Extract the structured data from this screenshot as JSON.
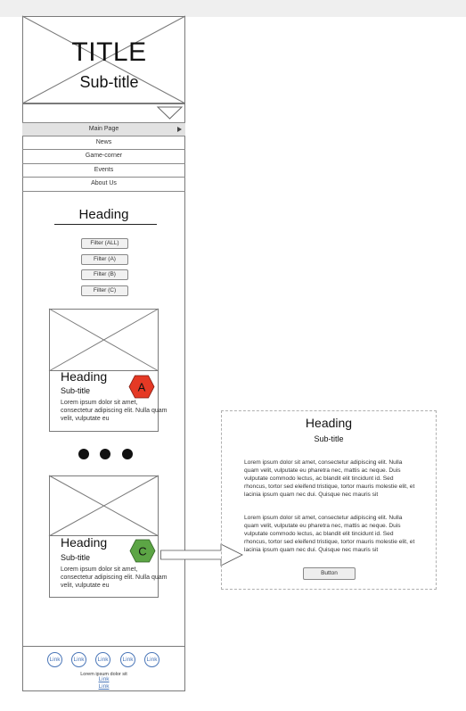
{
  "header": {
    "title": "TITLE",
    "subtitle": "Sub-title"
  },
  "nav": {
    "items": [
      "Main Page",
      "News",
      "Game-corner",
      "Events",
      "About Us"
    ],
    "active_index": 0
  },
  "section": {
    "heading": "Heading"
  },
  "filters": [
    "Filter (ALL)",
    "Filter (A)",
    "Filter (B)",
    "Filter (C)"
  ],
  "cards": [
    {
      "heading": "Heading",
      "subtitle": "Sub-title",
      "badge": "A",
      "badge_color": "#e53925",
      "text": "Lorem ipsum dolor sit amet, consectetur adipiscing elit. Nulla quam velit, vulputate eu"
    },
    {
      "heading": "Heading",
      "subtitle": "Sub-title",
      "badge": "C",
      "badge_color": "#5ca545",
      "text": "Lorem ipsum dolor sit amet, consectetur adipiscing elit. Nulla quam velit, vulputate eu"
    }
  ],
  "detail": {
    "heading": "Heading",
    "subtitle": "Sub-title",
    "paragraphs": [
      "Lorem ipsum dolor sit amet, consectetur adipiscing elit. Nulla quam velit, vulputate eu pharetra nec, mattis ac neque. Duis vulputate commodo lectus, ac blandit elit tincidunt id. Sed rhoncus, tortor sed eleifend tristique, tortor mauris molestie elit, et lacinia ipsum quam nec dui. Quisque nec mauris sit",
      "Lorem ipsum dolor sit amet, consectetur adipiscing elit. Nulla quam velit, vulputate eu pharetra nec, mattis ac neque. Duis vulputate commodo lectus, ac blandit elit tincidunt id. Sed rhoncus, tortor sed eleifend tristique, tortor mauris molestie elit, et lacinia ipsum quam nec dui. Quisque nec mauris sit"
    ],
    "button_label": "Button"
  },
  "footer": {
    "links": [
      "Link",
      "Link",
      "Link",
      "Link",
      "Link"
    ],
    "text": "Lorem ipsum dolor sit",
    "text_links": [
      "Link",
      "Link"
    ]
  }
}
